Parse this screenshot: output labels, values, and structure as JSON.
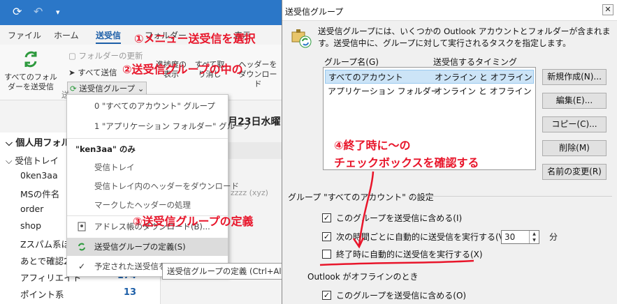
{
  "qat": {
    "sync_icon": "sync-icon",
    "undo_icon": "undo-icon",
    "customize_icon": "customize-icon"
  },
  "menu_tabs": [
    "ファイル",
    "ホーム",
    "送受信",
    "フォルダー",
    "表示"
  ],
  "ribbon": {
    "send_receive_all": "すべてのフォルダーを送受信",
    "update_folder": "フォルダーの更新",
    "send_all": "すべて送信",
    "send_receive_groups": "送受信グループ",
    "show_progress": "進捗度の表示",
    "cancel_all": "すべて取り消し",
    "download_headers": "ヘッダーをダウンロード",
    "group_label_snip": "送"
  },
  "dropdown": {
    "items": [
      {
        "text": "0 \"すべてのアカウント\" グループ",
        "type": "normal"
      },
      {
        "text": "1 \"アプリケーション フォルダー\" グループ",
        "type": "normal"
      },
      {
        "text": "\"ken3aa\" のみ",
        "type": "head"
      },
      {
        "text": "受信トレイ",
        "type": "sub"
      },
      {
        "text": "受信トレイ内のヘッダーをダウンロード",
        "type": "sub"
      },
      {
        "text": "マークしたヘッダーの処理",
        "type": "sub"
      },
      {
        "text": "アドレス帳のダウンロード(B)...",
        "type": "icon"
      },
      {
        "text": "送受信グループの定義(S)",
        "type": "highlight"
      },
      {
        "text": "予定された送受信を",
        "type": "check"
      }
    ]
  },
  "tooltip": "送受信グループの定義 (Ctrl+Alt",
  "date_strip": "月23日水曜",
  "sender_snippet": "zzzz (xyz)",
  "navpane": {
    "title": "個人用フォル",
    "inbox": "受信トレイ",
    "items": [
      {
        "label": "0ken3aa",
        "count": ""
      },
      {
        "label": "MSの件名",
        "count": ""
      },
      {
        "label": "order",
        "count": ""
      },
      {
        "label": "shop",
        "count": ""
      },
      {
        "label": "Zスパム系ほ",
        "count": ""
      },
      {
        "label": "あとで確認20",
        "count": ""
      },
      {
        "label": "アフィリエイト",
        "count": "174"
      },
      {
        "label": "ポイント系",
        "count": "13"
      }
    ]
  },
  "dialog": {
    "title": "送受信グループ",
    "close_icon": "close-icon",
    "description": "送受信グループには、いくつかの Outlook アカウントとフォルダーが含まれます。送受信中に、グループに対して実行されるタスクを指定します。",
    "col_group_name": "グループ名(G)",
    "col_timing": "送受信するタイミング",
    "groups": [
      {
        "name": "すべてのアカウント",
        "timing": "オンライン と オフライン",
        "selected": true
      },
      {
        "name": "アプリケーション フォルダー",
        "timing": "オンライン と オフライン",
        "selected": false
      }
    ],
    "buttons": [
      "新規作成(N)...",
      "編集(E)...",
      "コピー(C)...",
      "削除(M)",
      "名前の変更(R)"
    ],
    "settings_header": "グループ \"すべてのアカウント\" の設定",
    "cb_include": "このグループを送受信に含める(I)",
    "cb_auto_every": "次の時間ごとに自動的に送受信を実行する(V)",
    "interval_value": "30",
    "interval_unit": "分",
    "cb_on_exit": "終了時に自動的に送受信を実行する(X)",
    "offline_header": "Outlook がオフラインのとき",
    "cb_include_offline": "このグループを送受信に含める(O)"
  },
  "annotations": {
    "step1": "①メニュー送受信を選択",
    "step2": "②送受信グループの中の",
    "step3": "③送受信グループの定義",
    "step4_line1": "④終了時に～の",
    "step4_line2": "チェックボックスを確認する"
  },
  "colors": {
    "annotation_red": "#e8152a",
    "accent_blue": "#2b77c8",
    "selection_blue": "#cce4f7"
  }
}
